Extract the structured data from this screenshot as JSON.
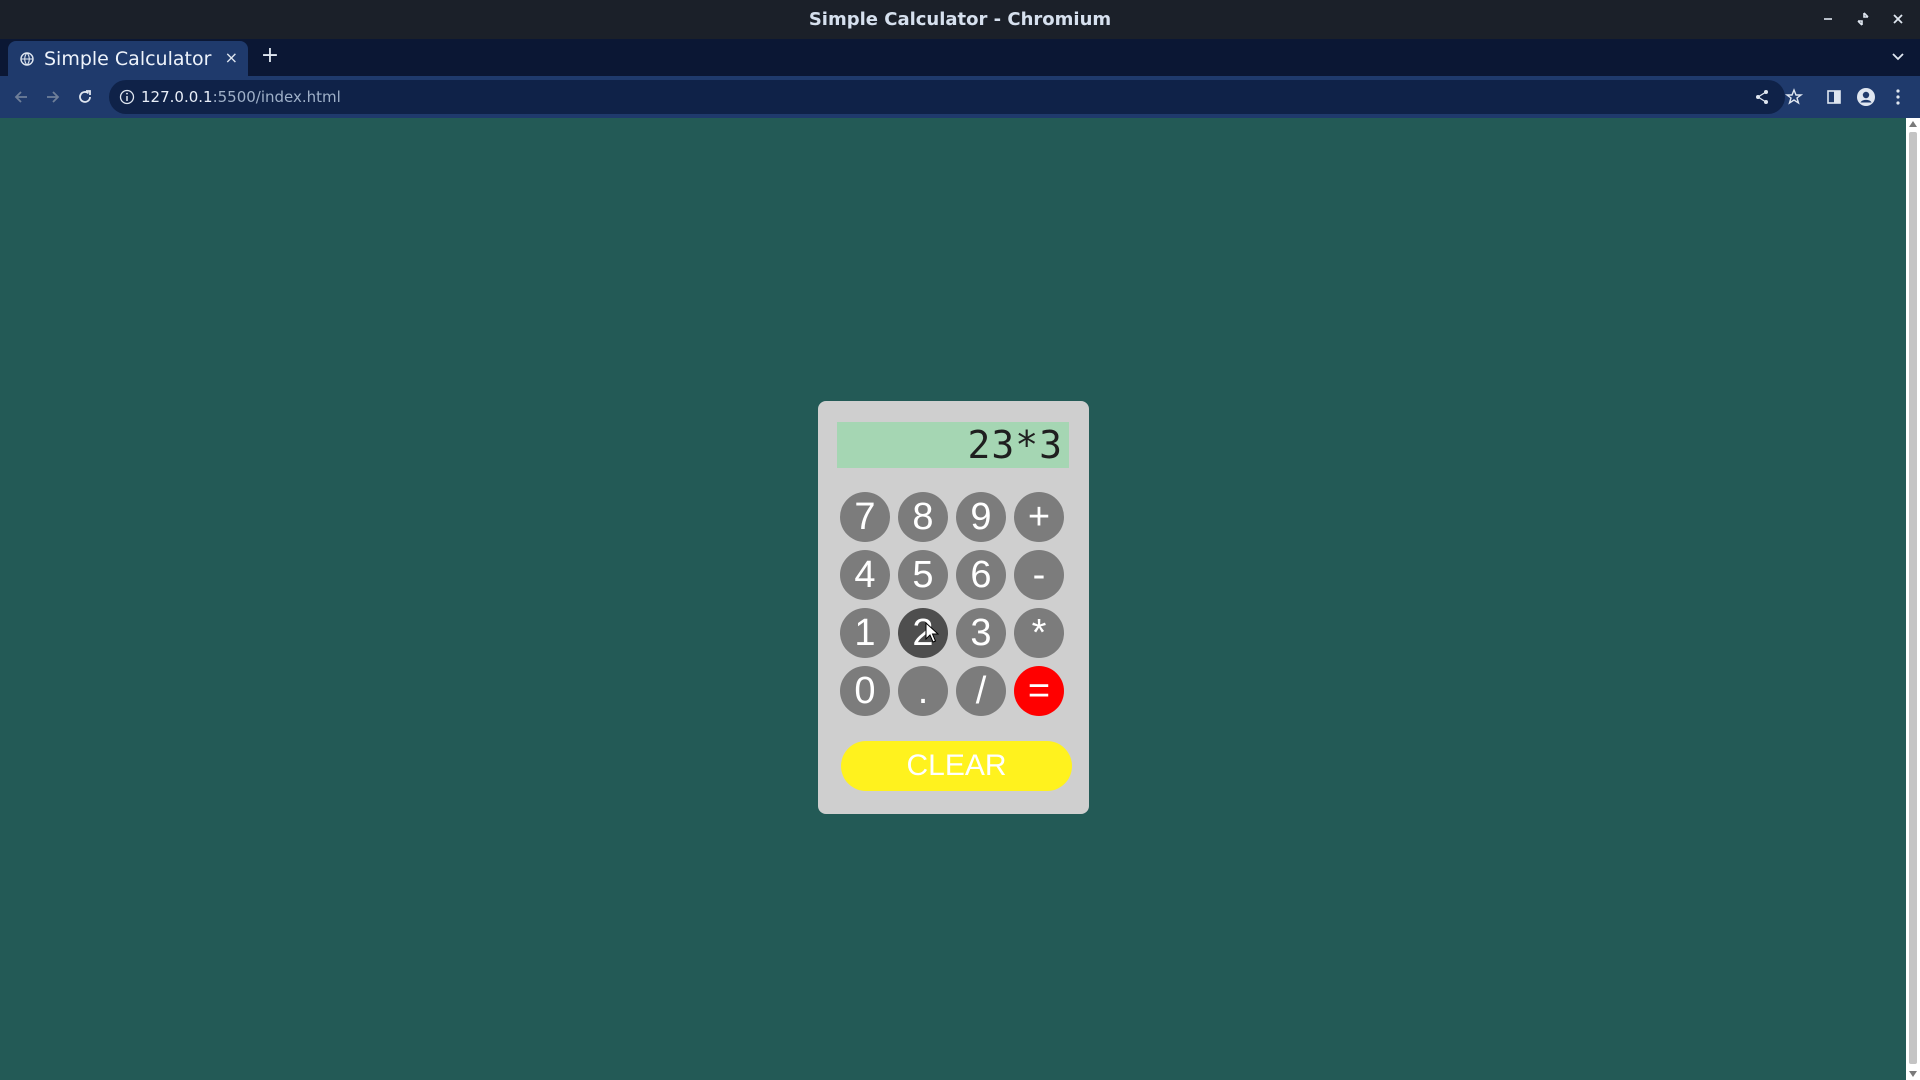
{
  "window": {
    "title": "Simple Calculator - Chromium"
  },
  "tab": {
    "label": "Simple Calculator",
    "close": "×",
    "new_tab": "+"
  },
  "address_bar": {
    "url_host": "127.0.0.1",
    "url_rest": ":5500/index.html"
  },
  "calculator": {
    "display": "23*3",
    "rows": [
      [
        "7",
        "8",
        "9",
        "+"
      ],
      [
        "4",
        "5",
        "6",
        "-"
      ],
      [
        "1",
        "2",
        "3",
        "*"
      ],
      [
        "0",
        ".",
        "/",
        "="
      ]
    ],
    "clear_label": "CLEAR"
  },
  "colors": {
    "page_background": "#235a56",
    "key": "#7c7c7c",
    "equals_key": "#ff0000",
    "clear_button": "#fff21e",
    "display": "#a5d6b3"
  },
  "icons": [
    "globe-icon",
    "back-icon",
    "forward-icon",
    "reload-icon",
    "info-icon",
    "share-icon",
    "star-icon",
    "sidepanel-icon",
    "profile-icon",
    "menu-icon"
  ]
}
